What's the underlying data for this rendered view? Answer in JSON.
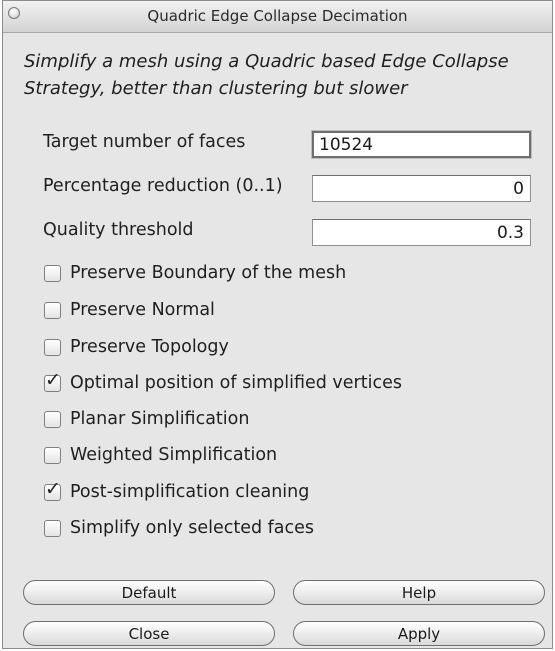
{
  "window": {
    "title": "Quadric Edge Collapse Decimation"
  },
  "description": "Simplify a mesh using a Quadric based Edge Collapse Strategy, better than clustering but slower",
  "fields": [
    {
      "label": "Target number of faces",
      "value": "10524"
    },
    {
      "label": "Percentage reduction (0..1)",
      "value": "0"
    },
    {
      "label": "Quality threshold",
      "value": "0.3"
    }
  ],
  "options": [
    {
      "label": "Preserve Boundary of the mesh",
      "checked": false
    },
    {
      "label": "Preserve Normal",
      "checked": false
    },
    {
      "label": "Preserve Topology",
      "checked": false
    },
    {
      "label": "Optimal position of simplified vertices",
      "checked": true
    },
    {
      "label": "Planar Simplification",
      "checked": false
    },
    {
      "label": "Weighted Simplification",
      "checked": false
    },
    {
      "label": "Post-simplification cleaning",
      "checked": true
    },
    {
      "label": "Simplify only selected faces",
      "checked": false
    }
  ],
  "buttons": {
    "default": "Default",
    "help": "Help",
    "close": "Close",
    "apply": "Apply"
  },
  "checkmark_glyph": "✓"
}
